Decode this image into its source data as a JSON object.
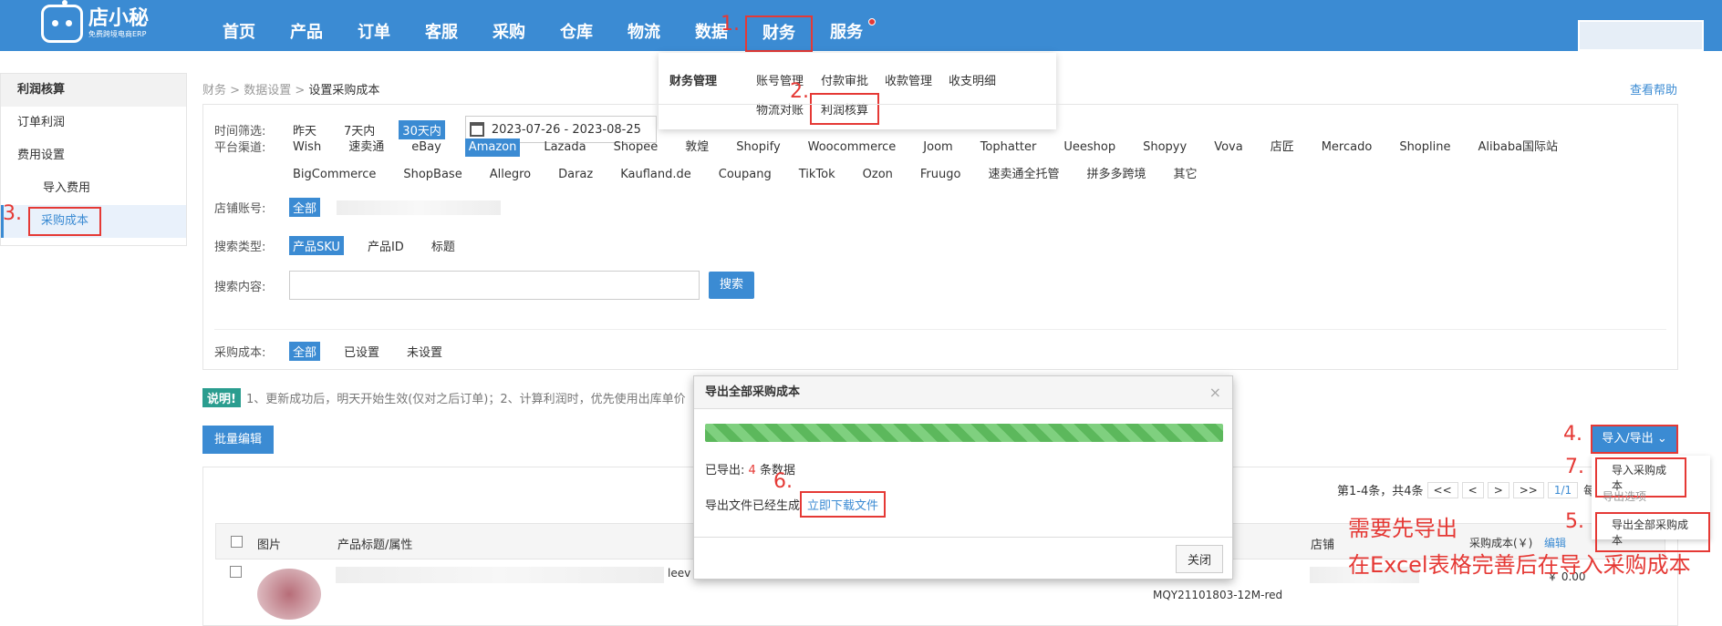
{
  "logo": {
    "title": "店小秘",
    "subtitle": "免费跨境电商ERP"
  },
  "nav": [
    "首页",
    "产品",
    "订单",
    "客服",
    "采购",
    "仓库",
    "物流",
    "数据",
    "财务",
    "服务"
  ],
  "annotations": [
    "1.",
    "2.",
    "3.",
    "4.",
    "5.",
    "6.",
    "7."
  ],
  "finance_menu": {
    "group": "财务管理",
    "links": [
      "账号管理",
      "付款审批",
      "收款管理",
      "收支明细",
      "物流对账",
      "利润核算"
    ]
  },
  "sidebar": {
    "header": "利润核算",
    "items": [
      "订单利润",
      "费用设置",
      "导入费用",
      "采购成本"
    ]
  },
  "breadcrumb": {
    "a": "财务",
    "b": "数据设置",
    "current": "设置采购成本",
    "sep": ">"
  },
  "help": "查看帮助",
  "filters": {
    "time_label": "时间筛选:",
    "time_options": [
      "昨天",
      "7天内",
      "30天内"
    ],
    "date_range": "2023-07-26 - 2023-08-25",
    "platform_label": "平台渠道:",
    "platforms": [
      "Wish",
      "速卖通",
      "eBay",
      "Amazon",
      "Lazada",
      "Shopee",
      "敦煌",
      "Shopify",
      "Woocommerce",
      "Joom",
      "Tophatter",
      "Ueeshop",
      "Shopyy",
      "Vova",
      "店匠",
      "Mercado",
      "Shopline",
      "Alibaba国际站",
      "BigCommerce",
      "ShopBase",
      "Allegro",
      "Daraz",
      "Kaufland.de",
      "Coupang",
      "TikTok",
      "Ozon",
      "Fruugo",
      "速卖通全托管",
      "拼多多跨境",
      "其它"
    ],
    "store_label": "店铺账号:",
    "store_all": "全部",
    "search_type_label": "搜索类型:",
    "search_types": [
      "产品SKU",
      "产品ID",
      "标题"
    ],
    "search_content_label": "搜索内容:",
    "search_button": "搜索",
    "cost_label": "采购成本:",
    "cost_options": [
      "全部",
      "已设置",
      "未设置"
    ]
  },
  "note": {
    "tag": "说明!",
    "text": "1、更新成功后，明天开始生效(仅对之后订单)；2、计算利润时，优先使用出库单价"
  },
  "batch_edit": "批量编辑",
  "pager": {
    "summary": "第1-4条，共4条",
    "first": "<<",
    "prev": "<",
    "next": ">",
    "last": ">>",
    "page": "1/1",
    "per": "每页"
  },
  "table": {
    "headers": [
      "图片",
      "产品标题/属性",
      "店铺",
      "采购成本(￥)",
      "编辑"
    ],
    "row": {
      "sku_prefix": "leev",
      "sku": "MQY21101803-12M-red",
      "cost": "￥ 0.00"
    }
  },
  "modal": {
    "title": "导出全部采购成本",
    "close_x": "×",
    "exported_label": "已导出:",
    "exported_count": "4",
    "exported_unit": "条数据",
    "generated_text": "导出文件已经生成",
    "download_link": "立即下载文件",
    "close_button": "关闭",
    "progress": 1.0
  },
  "io": {
    "button": "导入/导出",
    "items": [
      "导入采购成本",
      "导出选项",
      "导出全部采购成本"
    ]
  },
  "tip": {
    "line1": "需要先导出",
    "line2": "在Excel表格完善后在导入采购成本"
  }
}
